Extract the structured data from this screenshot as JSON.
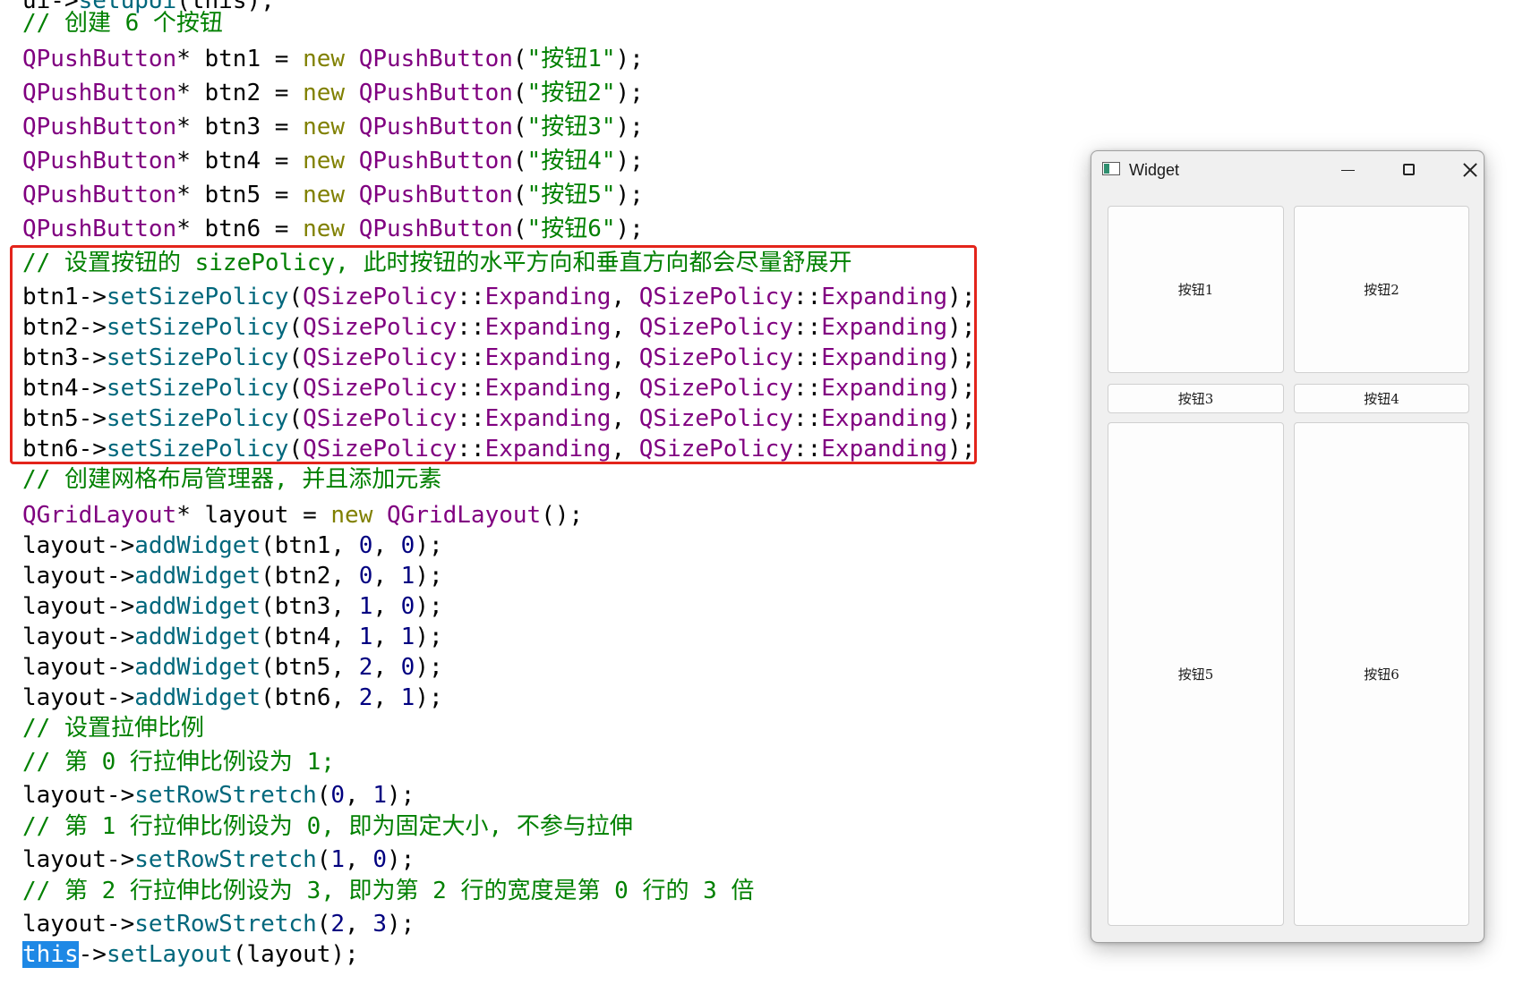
{
  "code": {
    "line0": {
      "a": "ui->",
      "b": "setupUi",
      "c": "(this);"
    },
    "line1": {
      "text": "// 创建 6 个按钮"
    },
    "buttons_decl": [
      {
        "type": "QPushButton",
        "star": "*",
        "var": " btn1 = ",
        "kw": "new",
        "sp": " ",
        "cls": "QPushButton",
        "open": "(",
        "str": "\"按钮1\"",
        "close": ");"
      },
      {
        "type": "QPushButton",
        "star": "*",
        "var": " btn2 = ",
        "kw": "new",
        "sp": " ",
        "cls": "QPushButton",
        "open": "(",
        "str": "\"按钮2\"",
        "close": ");"
      },
      {
        "type": "QPushButton",
        "star": "*",
        "var": " btn3 = ",
        "kw": "new",
        "sp": " ",
        "cls": "QPushButton",
        "open": "(",
        "str": "\"按钮3\"",
        "close": ");"
      },
      {
        "type": "QPushButton",
        "star": "*",
        "var": " btn4 = ",
        "kw": "new",
        "sp": " ",
        "cls": "QPushButton",
        "open": "(",
        "str": "\"按钮4\"",
        "close": ");"
      },
      {
        "type": "QPushButton",
        "star": "*",
        "var": " btn5 = ",
        "kw": "new",
        "sp": " ",
        "cls": "QPushButton",
        "open": "(",
        "str": "\"按钮5\"",
        "close": ");"
      },
      {
        "type": "QPushButton",
        "star": "*",
        "var": " btn6 = ",
        "kw": "new",
        "sp": " ",
        "cls": "QPushButton",
        "open": "(",
        "str": "\"按钮6\"",
        "close": ");"
      }
    ],
    "policy_comment": "// 设置按钮的 sizePolicy, 此时按钮的水平方向和垂直方向都会尽量舒展开",
    "policy_lines": [
      {
        "obj": "btn1->",
        "func": "setSizePolicy",
        "open": "(",
        "a": "QSizePolicy",
        "sep1": "::",
        "b": "Expanding",
        "mid": ", ",
        "c": "QSizePolicy",
        "sep2": "::",
        "d": "Expanding",
        "close": ");"
      },
      {
        "obj": "btn2->",
        "func": "setSizePolicy",
        "open": "(",
        "a": "QSizePolicy",
        "sep1": "::",
        "b": "Expanding",
        "mid": ", ",
        "c": "QSizePolicy",
        "sep2": "::",
        "d": "Expanding",
        "close": ");"
      },
      {
        "obj": "btn3->",
        "func": "setSizePolicy",
        "open": "(",
        "a": "QSizePolicy",
        "sep1": "::",
        "b": "Expanding",
        "mid": ", ",
        "c": "QSizePolicy",
        "sep2": "::",
        "d": "Expanding",
        "close": ");"
      },
      {
        "obj": "btn4->",
        "func": "setSizePolicy",
        "open": "(",
        "a": "QSizePolicy",
        "sep1": "::",
        "b": "Expanding",
        "mid": ", ",
        "c": "QSizePolicy",
        "sep2": "::",
        "d": "Expanding",
        "close": ");"
      },
      {
        "obj": "btn5->",
        "func": "setSizePolicy",
        "open": "(",
        "a": "QSizePolicy",
        "sep1": "::",
        "b": "Expanding",
        "mid": ", ",
        "c": "QSizePolicy",
        "sep2": "::",
        "d": "Expanding",
        "close": ");"
      },
      {
        "obj": "btn6->",
        "func": "setSizePolicy",
        "open": "(",
        "a": "QSizePolicy",
        "sep1": "::",
        "b": "Expanding",
        "mid": ", ",
        "c": "QSizePolicy",
        "sep2": "::",
        "d": "Expanding",
        "close": ");"
      }
    ],
    "grid_comment": "// 创建网格布局管理器, 并且添加元素",
    "grid_decl": {
      "type": "QGridLayout",
      "star": "*",
      "var": " layout = ",
      "kw": "new",
      "sp": " ",
      "cls": "QGridLayout",
      "close": "();"
    },
    "add_widgets": [
      {
        "obj": "layout->",
        "func": "addWidget",
        "open": "(btn1, ",
        "r": "0",
        "comma": ", ",
        "c": "0",
        "close": ");"
      },
      {
        "obj": "layout->",
        "func": "addWidget",
        "open": "(btn2, ",
        "r": "0",
        "comma": ", ",
        "c": "1",
        "close": ");"
      },
      {
        "obj": "layout->",
        "func": "addWidget",
        "open": "(btn3, ",
        "r": "1",
        "comma": ", ",
        "c": "0",
        "close": ");"
      },
      {
        "obj": "layout->",
        "func": "addWidget",
        "open": "(btn4, ",
        "r": "1",
        "comma": ", ",
        "c": "1",
        "close": ");"
      },
      {
        "obj": "layout->",
        "func": "addWidget",
        "open": "(btn5, ",
        "r": "2",
        "comma": ", ",
        "c": "0",
        "close": ");"
      },
      {
        "obj": "layout->",
        "func": "addWidget",
        "open": "(btn6, ",
        "r": "2",
        "comma": ", ",
        "c": "1",
        "close": ");"
      }
    ],
    "stretch_comment": "// 设置拉伸比例",
    "row0_comment": "// 第 0 行拉伸比例设为 1;",
    "row0_code": {
      "obj": "layout->",
      "func": "setRowStretch",
      "open": "(",
      "a": "0",
      "comma": ", ",
      "b": "1",
      "close": ");"
    },
    "row1_comment": "// 第 1 行拉伸比例设为 0, 即为固定大小, 不参与拉伸",
    "row1_code": {
      "obj": "layout->",
      "func": "setRowStretch",
      "open": "(",
      "a": "1",
      "comma": ", ",
      "b": "0",
      "close": ");"
    },
    "row2_comment": "// 第 2 行拉伸比例设为 3, 即为第 2 行的宽度是第 0 行的 3 倍",
    "row2_code": {
      "obj": "layout->",
      "func": "setRowStretch",
      "open": "(",
      "a": "2",
      "comma": ", ",
      "b": "3",
      "close": ");"
    },
    "last_line": {
      "sel": "this",
      "obj": "->",
      "func": "setLayout",
      "rest": "(layout);"
    }
  },
  "widget_window": {
    "title": "Widget",
    "buttons": [
      "按钮1",
      "按钮2",
      "按钮3",
      "按钮4",
      "按钮5",
      "按钮6"
    ]
  },
  "colors": {
    "highlight_border": "#e3241b",
    "selection": "#1e88e5",
    "comment": "#008000",
    "type": "#800080",
    "function": "#00677c",
    "keyword": "#808000",
    "number": "#000080"
  }
}
